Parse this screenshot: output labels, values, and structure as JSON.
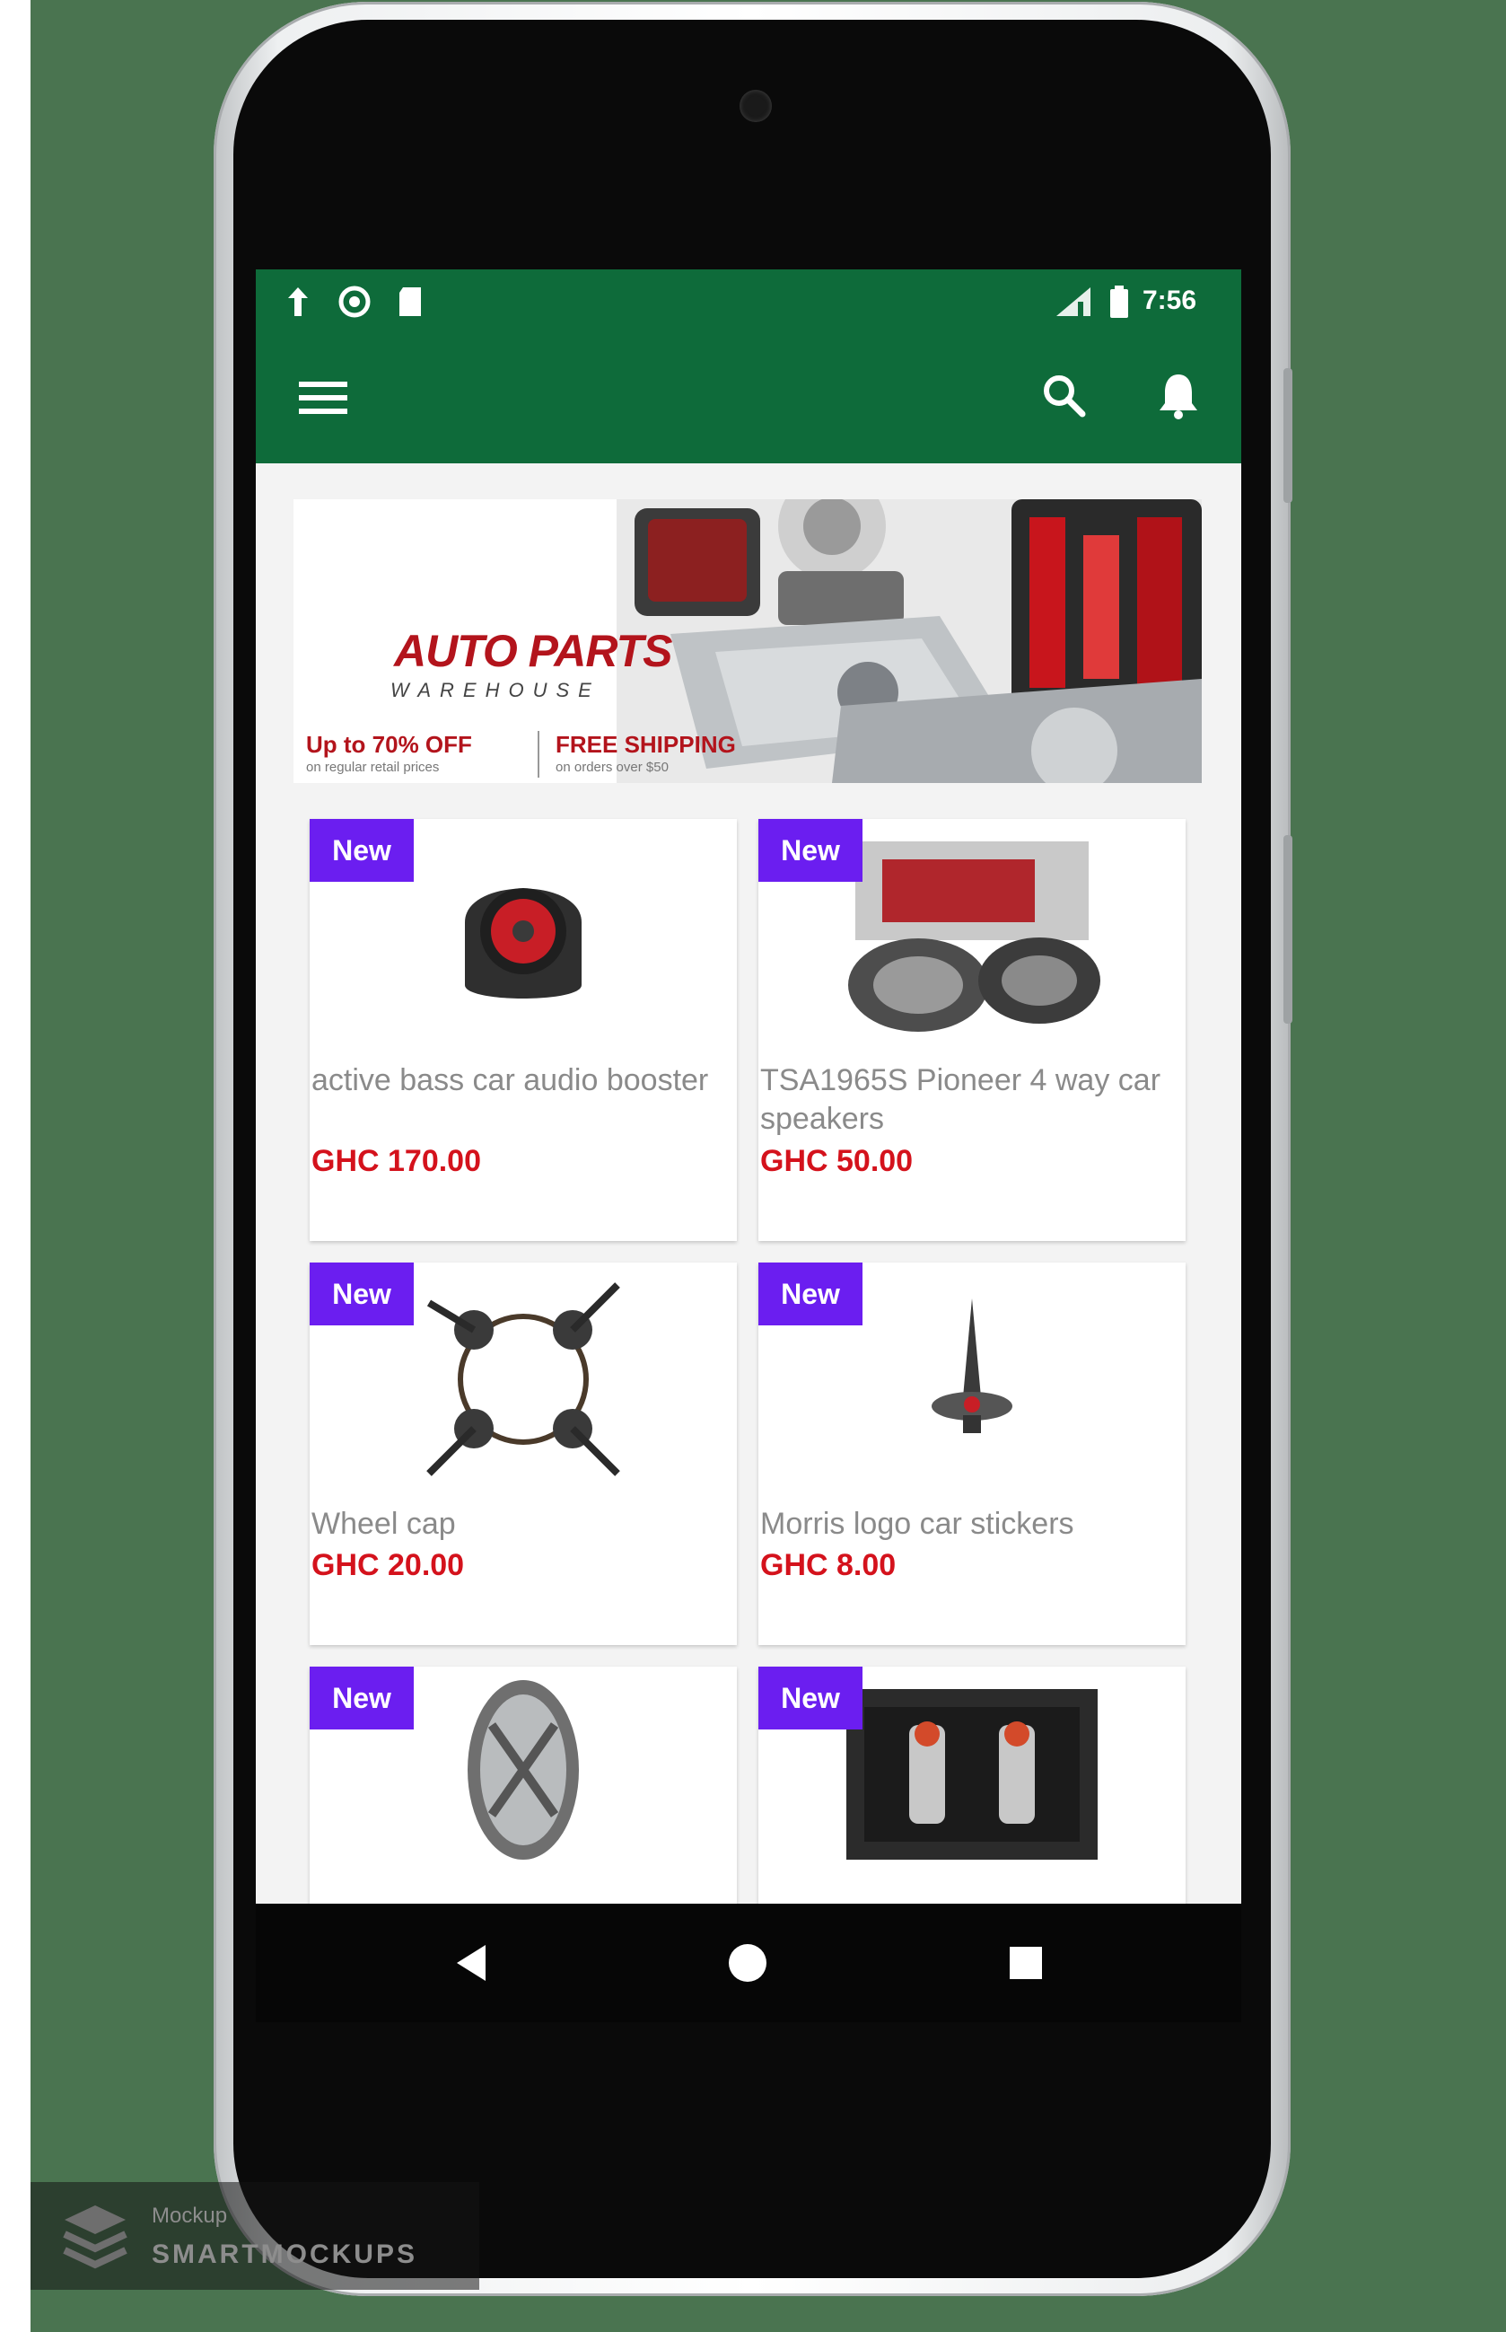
{
  "status_bar": {
    "time": "7:56",
    "left_icons": [
      "upload-icon",
      "circle-status-icon",
      "sd-card-icon"
    ],
    "right_icons": [
      "signal-icon",
      "battery-icon"
    ]
  },
  "app_bar": {
    "background": "#0e6b3a",
    "icons": [
      "menu-icon",
      "search-icon",
      "bell-icon"
    ]
  },
  "banner": {
    "title": "AUTO PARTS",
    "subtitle": "WAREHOUSE",
    "offer": "Up to 70% OFF",
    "offer_sub": "on regular retail prices",
    "shipping": "FREE SHIPPING",
    "shipping_sub": "on orders over $50"
  },
  "products": [
    {
      "badge": "New",
      "name": "active bass car audio booster",
      "price": "GHC 170.00"
    },
    {
      "badge": "New",
      "name": "TSA1965S Pioneer 4 way car speakers",
      "price": "GHC 50.00"
    },
    {
      "badge": "New",
      "name": "Wheel cap",
      "price": "GHC 20.00"
    },
    {
      "badge": "New",
      "name": "Morris logo car stickers",
      "price": "GHC 8.00"
    },
    {
      "badge": "New",
      "name": "",
      "price": ""
    },
    {
      "badge": "New",
      "name": "",
      "price": ""
    }
  ],
  "nav_bar": {
    "buttons": [
      "back-icon",
      "home-icon",
      "recents-icon"
    ]
  },
  "colors": {
    "accent_green": "#0e6b3a",
    "badge_purple": "#6b1ef0",
    "price_red": "#d4121c"
  },
  "watermark": {
    "line1": "Mockup",
    "line2": "SMARTMOCKUPS"
  }
}
